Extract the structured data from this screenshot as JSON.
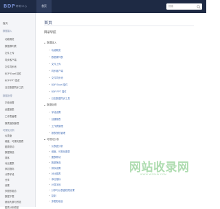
{
  "header": {
    "logo": "BDP",
    "subtitle": "帮助中心",
    "nav_home": "首页",
    "search_placeholder": "搜索"
  },
  "sidebar": {
    "top": "首页",
    "groups": [
      {
        "title": "数据接入",
        "items": [
          "功能概览",
          "数据源列表",
          "文件上传",
          "同步客户端",
          "文件同步池",
          "BDP Excel 插件",
          "BDP FPT 插件",
          "日志数据同步工具"
        ]
      },
      {
        "title": "数据处理",
        "items": [
          "字段设置",
          "创建报表",
          "工作表管理",
          "报表授权管理"
        ]
      },
      {
        "title": "可视化分析",
        "items": [
          "仪表盘",
          "维度、可视化图表",
          "图表联动",
          "数据筛选",
          "排序",
          "对比图表",
          "添加指标",
          "计算字段",
          "分享",
          "设置",
          "多图形组合",
          "数据下载",
          "使用大屏与预览",
          "图表分析模型"
        ]
      }
    ]
  },
  "main": {
    "title": "首页",
    "toc_title": "目录导航",
    "sections": [
      {
        "label": "数据接入",
        "items": [
          "功能概览",
          "数据源列表",
          "文件上传",
          "同步客户端",
          "文件同步池",
          "BDP Excel 插件",
          "BDP FPT 插件",
          "日志数据同步工具"
        ]
      },
      {
        "label": "数据处理",
        "items": [
          "字段设置",
          "创建报表",
          "工作表管理",
          "报表授权管理"
        ]
      },
      {
        "label": "可视化分析",
        "items": [
          "仪表盘分析",
          "维度、可视化图表",
          "图表联动",
          "数据筛选",
          "排序设置",
          "对比图表",
          "添加指标",
          "计算字段",
          "分享与仪表盘权限设置",
          "复制",
          "多图形组合",
          "数据下载",
          "图表分析模型"
        ]
      }
    ]
  },
  "watermark": {
    "text": "网站收录网",
    "url": "WWW.WZSLW.COM"
  },
  "colors": {
    "topbar": "#1e2a44",
    "link": "#4a73b8",
    "sidebar_bg": "#f4f5f8"
  }
}
